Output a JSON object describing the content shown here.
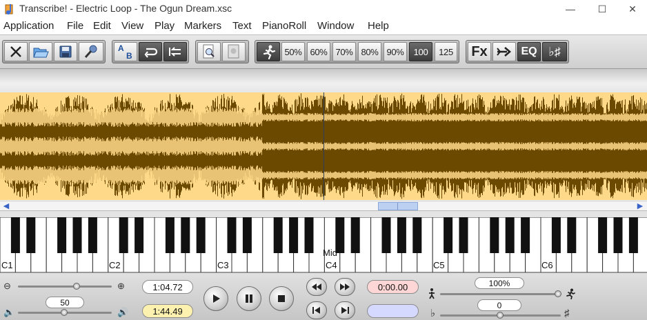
{
  "window": {
    "title": "Transcribe! - Electric Loop - The Ogun Dream.xsc",
    "controls": {
      "minimize": "—",
      "maximize": "☐",
      "close": "✕"
    }
  },
  "menu": [
    "Application",
    "File",
    "Edit",
    "View",
    "Play",
    "Markers",
    "Text",
    "PianoRoll",
    "Window",
    "Help"
  ],
  "toolbar": {
    "speeds": [
      "50%",
      "60%",
      "70%",
      "80%",
      "90%",
      "100",
      "125"
    ],
    "selected_speed": "100",
    "fx_label": "Fx",
    "eq_label": "EQ",
    "key_label": "♭♯",
    "ab_label_a": "A",
    "ab_label_b": "B"
  },
  "piano": {
    "octave_labels": [
      "C1",
      "C2",
      "C3",
      "C4",
      "C5",
      "C6"
    ],
    "mid_label": "Mid"
  },
  "bottom": {
    "position_time": "1:04.72",
    "total_time": "1:44.49",
    "volume_value": "50",
    "loop_time": "0:00.00",
    "speed_value": "100%",
    "pitch_value": "0"
  },
  "colors": {
    "wave_fg": "#6b4a00",
    "wave_bg": "#ffd98a",
    "speed_selected": "#3c3c3c",
    "time_total_bg": "#fdf1b0",
    "loop_bg": "#ffd6d6",
    "loop_empty_bg": "#d6d9ff"
  }
}
